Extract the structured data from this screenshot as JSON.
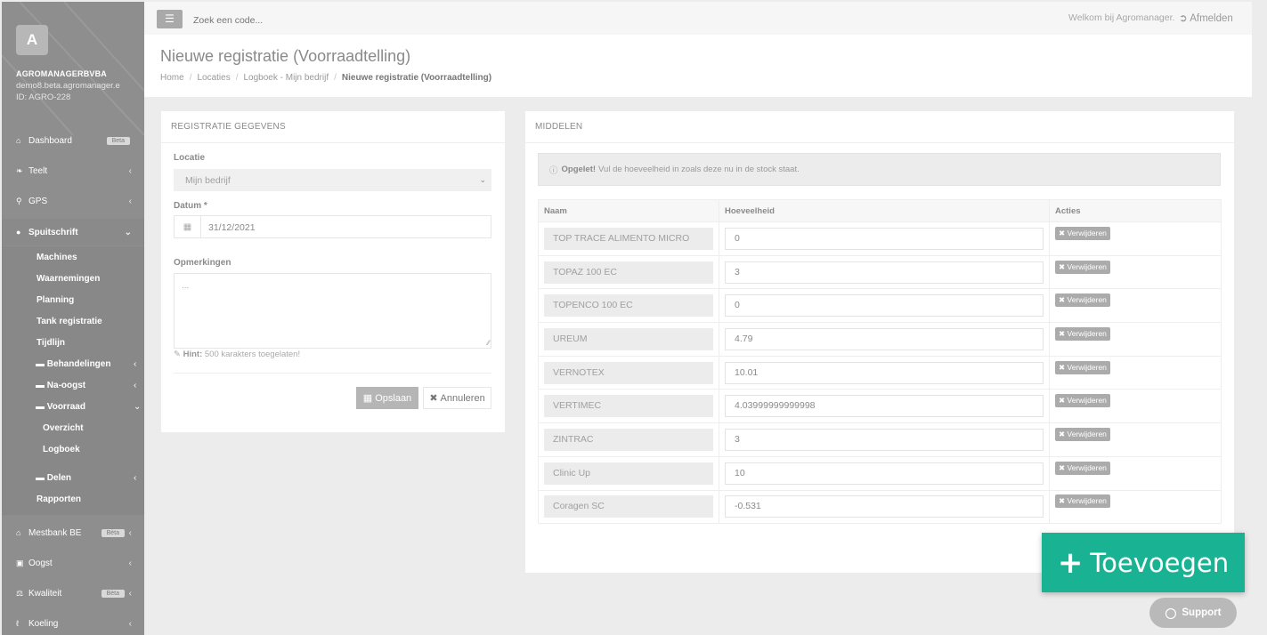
{
  "sidebar": {
    "logo_letter": "A",
    "company_name": "AGROMANAGERBVBA",
    "company_email": "demo8.beta.agromanager.e",
    "company_id": "ID: AGRO-228",
    "items": [
      {
        "label": "Dashboard",
        "icon": "home-icon",
        "badge": "Beta"
      },
      {
        "label": "Teelt",
        "icon": "leaf-icon"
      },
      {
        "label": "GPS",
        "icon": "map-marker-icon"
      },
      {
        "label": "Spuitschrift",
        "icon": "tint-icon"
      },
      {
        "label": "Mestbank BE",
        "icon": "bank-icon",
        "badge": "Bèta"
      },
      {
        "label": "Oogst",
        "icon": "basket-icon"
      },
      {
        "label": "Kwaliteit",
        "icon": "balance-icon",
        "badge": "Bèta"
      },
      {
        "label": "Koeling",
        "icon": "thermometer-icon"
      }
    ],
    "spuitschrift_sub": {
      "machines": "Machines",
      "waarnemingen": "Waarnemingen",
      "planning": "Planning",
      "tank": "Tank registratie",
      "tijdlijn": "Tijdlijn",
      "behandelingen": "Behandelingen",
      "na_oogst": "Na-oogst",
      "voorraad": "Voorraad",
      "overzicht": "Overzicht",
      "logboek": "Logboek",
      "delen": "Delen",
      "rapporten": "Rapporten"
    }
  },
  "topbar": {
    "search_placeholder": "Zoek een code...",
    "welcome": "Welkom bij Agromanager.",
    "logout": "Afmelden"
  },
  "header": {
    "title": "Nieuwe registratie (Voorraadtelling)",
    "breadcrumb": [
      "Home",
      "Locaties",
      "Logboek - Mijn bedrijf",
      "Nieuwe registratie (Voorraadtelling)"
    ]
  },
  "form": {
    "panel_title": "REGISTRATIE GEGEVENS",
    "locatie_label": "Locatie",
    "locatie_value": "Mijn bedrijf",
    "datum_label": "Datum *",
    "datum_value": "31/12/2021",
    "opmerkingen_label": "Opmerkingen",
    "opmerkingen_placeholder": "...",
    "hint_label": "Hint:",
    "hint_text": "500 karakters toegelaten!",
    "save_label": "Opslaan",
    "cancel_label": "Annuleren"
  },
  "middelen": {
    "panel_title": "MIDDELEN",
    "alert_strong": "Opgelet!",
    "alert_text": "Vul de hoeveelheid in zoals deze nu in de stock staat.",
    "columns": [
      "Naam",
      "Hoeveelheid",
      "Acties"
    ],
    "delete_label": "Verwijderen",
    "rows": [
      {
        "name": "TOP TRACE ALIMENTO MICRO",
        "qty": "0"
      },
      {
        "name": "TOPAZ 100 EC",
        "qty": "3"
      },
      {
        "name": "TOPENCO 100 EC",
        "qty": "0"
      },
      {
        "name": "UREUM",
        "qty": "4.79"
      },
      {
        "name": "VERNOTEX",
        "qty": "10.01"
      },
      {
        "name": "VERTIMEC",
        "qty": "4.03999999999998"
      },
      {
        "name": "ZINTRAC",
        "qty": "3"
      },
      {
        "name": "Clinic Up",
        "qty": "10"
      },
      {
        "name": "Coragen SC",
        "qty": "-0.531"
      }
    ]
  },
  "floating": {
    "add_label": "Toevoegen",
    "support_label": "Support"
  },
  "colors": {
    "accent": "#19b394",
    "sidebar": "#8e8e8e"
  }
}
